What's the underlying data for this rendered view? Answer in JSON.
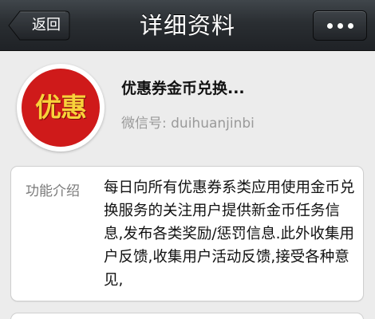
{
  "nav": {
    "title": "详细资料",
    "back_label": "返回",
    "more_icon": "more-dots-icon"
  },
  "profile": {
    "avatar_text": "优惠",
    "avatar_bg": "#cf1a1a",
    "avatar_fg": "#f8d23a",
    "name": "优惠券金币兑换...",
    "wechat_id": "微信号: duihuanjinbi"
  },
  "intro": {
    "label": "功能介绍",
    "text": "每日向所有优惠券系类应用使用金币兑换服务的关注用户提供新金币任务信息,发布各类奖励/惩罚信息.此外收集用户反馈,收集用户活动反馈,接受各种意见,"
  }
}
